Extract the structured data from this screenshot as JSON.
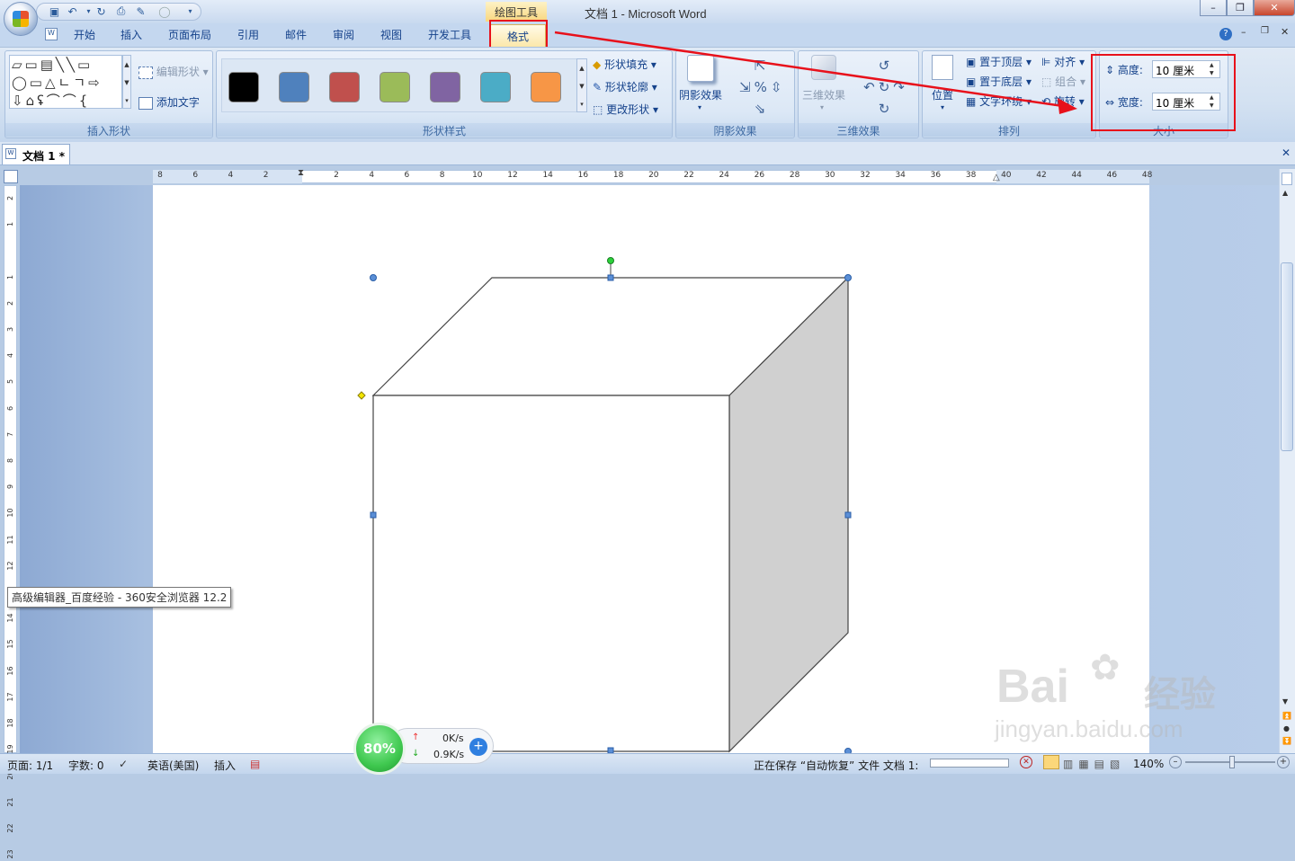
{
  "window": {
    "title": "文档 1 - Microsoft Word",
    "context_tool": "绘图工具"
  },
  "tabs": [
    "开始",
    "插入",
    "页面布局",
    "引用",
    "邮件",
    "审阅",
    "视图",
    "开发工具",
    "格式"
  ],
  "ribbon": {
    "insert_shapes": {
      "label": "插入形状",
      "edit_shape": "编辑形状",
      "add_text": "添加文字"
    },
    "shape_styles": {
      "label": "形状样式",
      "fill": "形状填充",
      "outline": "形状轮廓",
      "change_shape": "更改形状",
      "swatches": [
        "#000000",
        "#4f81bd",
        "#c0504d",
        "#9bbb59",
        "#8064a2",
        "#4bacc6",
        "#f79646"
      ]
    },
    "shadow": {
      "label": "阴影效果",
      "button": "阴影效果"
    },
    "threed": {
      "label": "三维效果",
      "button": "三维效果"
    },
    "arrange": {
      "label": "排列",
      "position": "位置",
      "bring_front": "置于顶层",
      "send_back": "置于底层",
      "wrap": "文字环绕",
      "align": "对齐",
      "group": "组合",
      "rotate": "旋转"
    },
    "size": {
      "label": "大小",
      "height_label": "高度:",
      "height_value": "10 厘米",
      "width_label": "宽度:",
      "width_value": "10 厘米"
    }
  },
  "document": {
    "tab": "文档 1 *"
  },
  "ruler": {
    "h_marks": [
      "8",
      "6",
      "4",
      "2",
      "",
      "2",
      "4",
      "6",
      "8",
      "10",
      "12",
      "14",
      "16",
      "18",
      "20",
      "22",
      "24",
      "26",
      "28",
      "30",
      "32",
      "34",
      "36",
      "38",
      "40",
      "42",
      "44",
      "46",
      "48"
    ],
    "v_marks": [
      "2",
      "1",
      "",
      "1",
      "2",
      "3",
      "4",
      "5",
      "6",
      "7",
      "8",
      "9",
      "10",
      "11",
      "12",
      "13",
      "14",
      "15",
      "16",
      "17",
      "18",
      "19",
      "20",
      "21",
      "22",
      "23"
    ]
  },
  "tooltip": "高级编辑器_百度经验 - 360安全浏览器 12.2",
  "speed": {
    "percent": "80%",
    "up": "0K/s",
    "down": "0.9K/s"
  },
  "status": {
    "page": "页面: 1/1",
    "words": "字数: 0",
    "lang": "英语(美国)",
    "mode": "插入",
    "saving": "正在保存 “自动恢复” 文件 文档 1:",
    "zoom": "140%"
  },
  "watermark": {
    "brand": "Bai",
    "brand2": "经验",
    "url": "jingyan.baidu.com"
  },
  "colors": {
    "annotation": "#e8111b",
    "cube_side": "#d0d0d0",
    "handle": "#5b8fd6"
  }
}
